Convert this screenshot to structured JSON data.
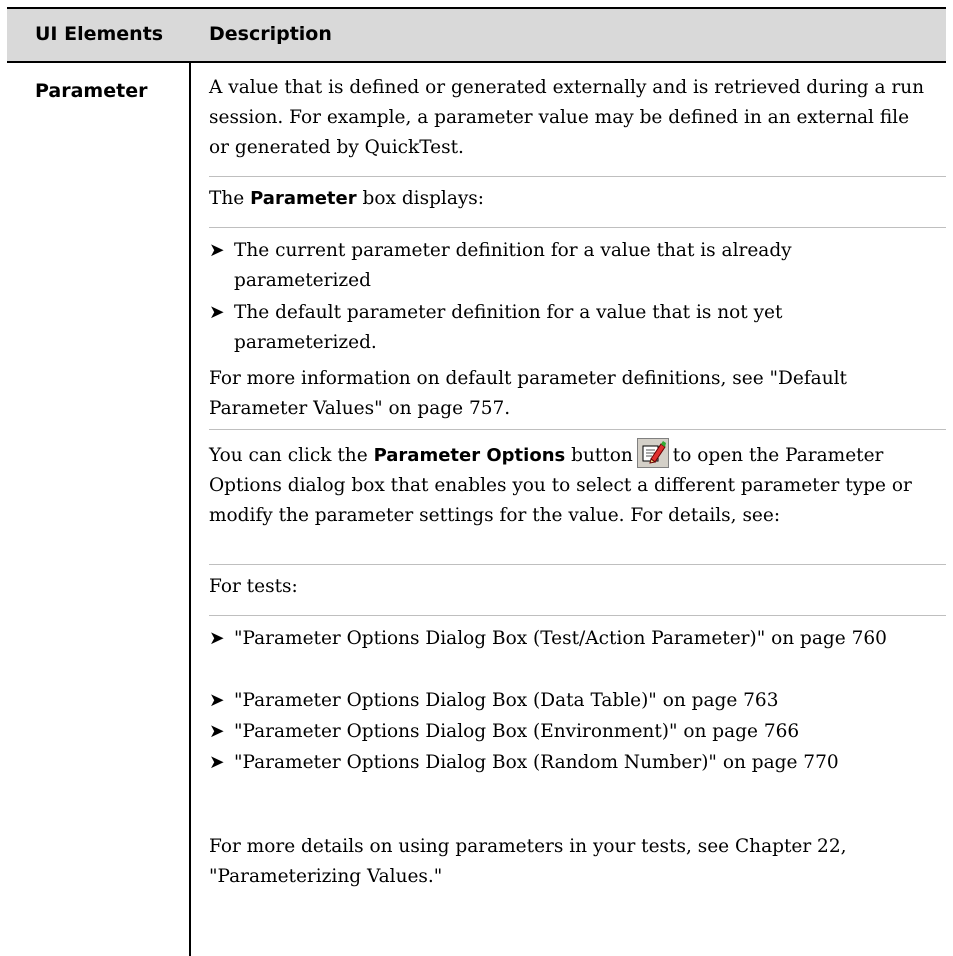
{
  "table": {
    "header": {
      "col1": "UI Elements",
      "col2": "Description"
    },
    "row": {
      "label": "Parameter",
      "intro": "A value that is defined or generated externally and is retrieved during a run session. For example, a parameter value may be defined in an external file or generated by QuickTest.",
      "box_prefix": "The ",
      "box_bold": "Parameter",
      "box_suffix": " box displays:",
      "box_bullets": [
        "The current parameter definition for a value that is already parameterized",
        "The default parameter definition for a value that is not yet parameterized."
      ],
      "more_info": "For more information on default parameter definitions, see \"Default Parameter Values\" on page 757.",
      "options_prefix": "You can click the ",
      "options_bold": "Parameter Options",
      "options_mid": " button",
      "options_suffix": "to open the Parameter Options dialog box that enables you to select a different parameter type or modify the parameter settings for the value. For details, see:",
      "for_tests": "For tests:",
      "test_bullets": [
        "\"Parameter Options Dialog Box (Test/Action Parameter)\" on page 760",
        "\"Parameter Options Dialog Box (Data Table)\" on page 763",
        "\"Parameter Options Dialog Box (Environment)\" on page 766",
        "\"Parameter Options Dialog Box (Random Number)\" on page 770"
      ],
      "more_details": "For more details on using parameters in your tests, see Chapter 22, \"Parameterizing Values.\"",
      "bullet_glyph": "➤",
      "icon": "parameter-options-icon"
    }
  }
}
